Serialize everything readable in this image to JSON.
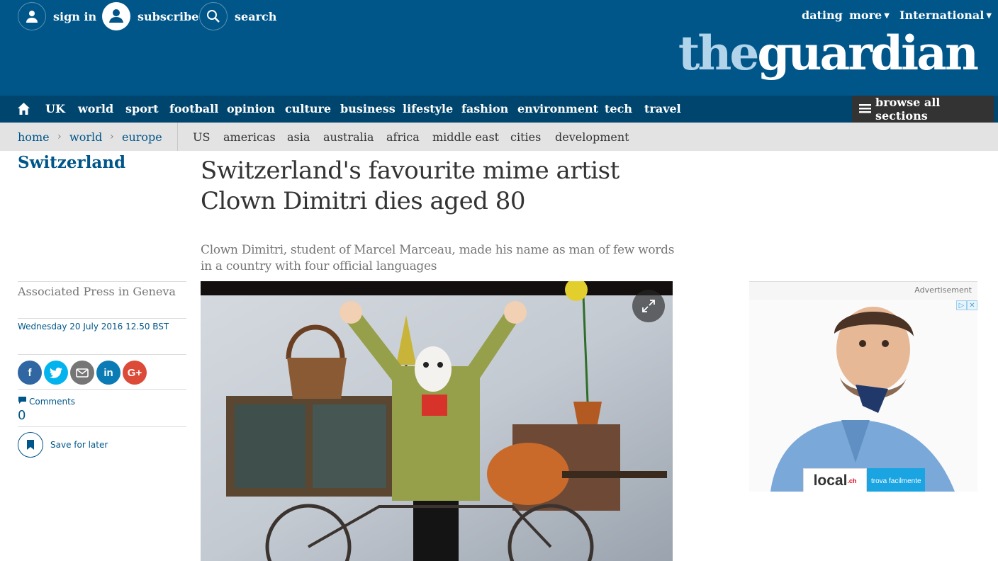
{
  "topbar": {
    "sign_in": "sign in",
    "subscribe": "subscribe",
    "search": "search",
    "dating": "dating",
    "more": "more",
    "international": "International",
    "logo_the": "the",
    "logo_guardian": "guardian"
  },
  "nav": {
    "items": [
      "UK",
      "world",
      "sport",
      "football",
      "opinion",
      "culture",
      "business",
      "lifestyle",
      "fashion",
      "environment",
      "tech",
      "travel"
    ],
    "browse_all": "browse all sections"
  },
  "subnav": {
    "breadcrumbs": [
      "home",
      "world",
      "europe"
    ],
    "items": [
      "US",
      "americas",
      "asia",
      "australia",
      "africa",
      "middle east",
      "cities",
      "development"
    ]
  },
  "article": {
    "section": "Switzerland",
    "headline": "Switzerland's favourite mime artist Clown Dimitri dies aged 80",
    "standfirst": "Clown Dimitri, student of Marcel Marceau, made his name as man of few words in a country with four official languages",
    "byline": "Associated Press in Geneva",
    "date": "Wednesday 20 July 2016 12.50 BST",
    "comments_label": "Comments",
    "comments_count": "0",
    "save_label": "Save for later"
  },
  "share_icons": [
    "facebook-icon",
    "twitter-icon",
    "email-icon",
    "linkedin-icon",
    "googleplus-icon"
  ],
  "ad": {
    "label": "Advertisement",
    "brand": "local",
    "brand_suffix": ".ch",
    "tagline": "trova facilmente"
  },
  "colors": {
    "header_blue": "#005689",
    "nav_blue": "#00456e",
    "logo_light": "#b2d4ea",
    "facebook": "#3067a3",
    "twitter": "#03b3ee",
    "email": "#767676",
    "linkedin": "#0b7bb5",
    "googleplus": "#dc4a38"
  }
}
